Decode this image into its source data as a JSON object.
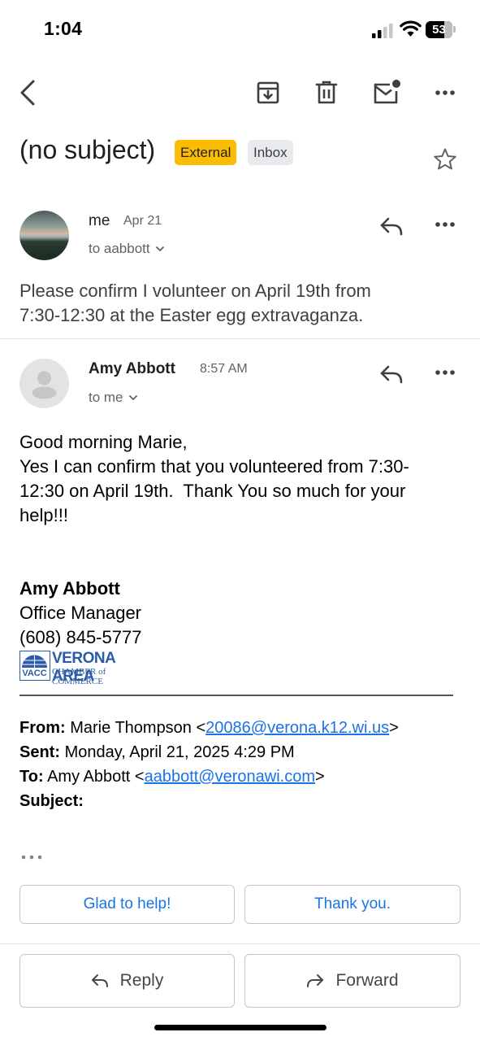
{
  "status_bar": {
    "time": "1:04",
    "battery": "53"
  },
  "toolbar": {
    "icons": [
      "back-icon",
      "archive-icon",
      "trash-icon",
      "mark-unread-icon",
      "more-icon"
    ]
  },
  "email": {
    "subject": "(no subject)",
    "labels": [
      "External",
      "Inbox"
    ]
  },
  "messages": [
    {
      "sender": "me",
      "time": "Apr 21",
      "to": "to aabbott",
      "body": [
        "Please confirm I volunteer on April 19th from",
        "7:30-12:30 at the Easter egg extravaganza."
      ]
    },
    {
      "sender": "Amy Abbott",
      "time": "8:57 AM",
      "to": "to me",
      "body": [
        "Good morning Marie,",
        "Yes I can confirm that you volunteered from 7:30-",
        "12:30 on April 19th.  Thank You so much for your",
        "help!!!"
      ],
      "signature": {
        "name": "Amy Abbott",
        "title": "Office Manager",
        "phone": "(608) 845-5777",
        "logo_text": "VERONA AREA",
        "logo_sub": "CHAMBER of COMMERCE",
        "logo_abbr": "VACC"
      },
      "quoted": {
        "from_label": "From:",
        "from_name": "Marie Thompson <",
        "from_email": "20086@verona.k12.wi.us",
        "from_close": ">",
        "sent_label": "Sent:",
        "sent_value": "Monday, April 21, 2025 4:29 PM",
        "to_label": "To:",
        "to_name": "Amy Abbott <",
        "to_email": "aabbott@veronawi.com",
        "to_close": ">",
        "subject_label": "Subject:"
      }
    }
  ],
  "smart_replies": [
    "Glad to help!",
    "Thank you."
  ],
  "actions": {
    "reply": "Reply",
    "forward": "Forward"
  },
  "colors": {
    "accent": "#1a73e8",
    "external_chip": "#fbbc04",
    "inbox_chip": "#e8eaed"
  }
}
